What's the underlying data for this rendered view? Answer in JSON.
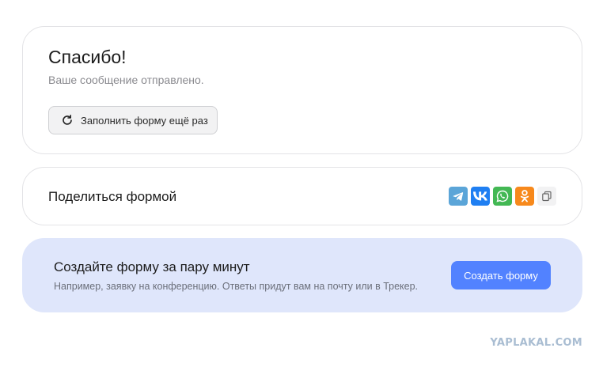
{
  "thanks": {
    "title": "Спасибо!",
    "subtitle": "Ваше сообщение отправлено.",
    "refill_label": "Заполнить форму ещё раз",
    "refill_icon": "refresh-icon"
  },
  "share": {
    "title": "Поделиться формой",
    "icons": [
      {
        "name": "telegram-icon",
        "color": "#5ba5d8"
      },
      {
        "name": "vk-icon",
        "color": "#1f7ff2"
      },
      {
        "name": "whatsapp-icon",
        "color": "#43b854"
      },
      {
        "name": "odnoklassniki-icon",
        "color": "#f7891c"
      },
      {
        "name": "copy-link-icon",
        "color": "#f2f2f3"
      }
    ]
  },
  "promo": {
    "title": "Создайте форму за пару минут",
    "subtitle": "Например, заявку на конференцию. Ответы придут вам на почту или в Трекер.",
    "button_label": "Создать форму",
    "background": "#dfe6fb",
    "accent": "#5282ff"
  },
  "watermark": "YAPLAKAL.COM"
}
